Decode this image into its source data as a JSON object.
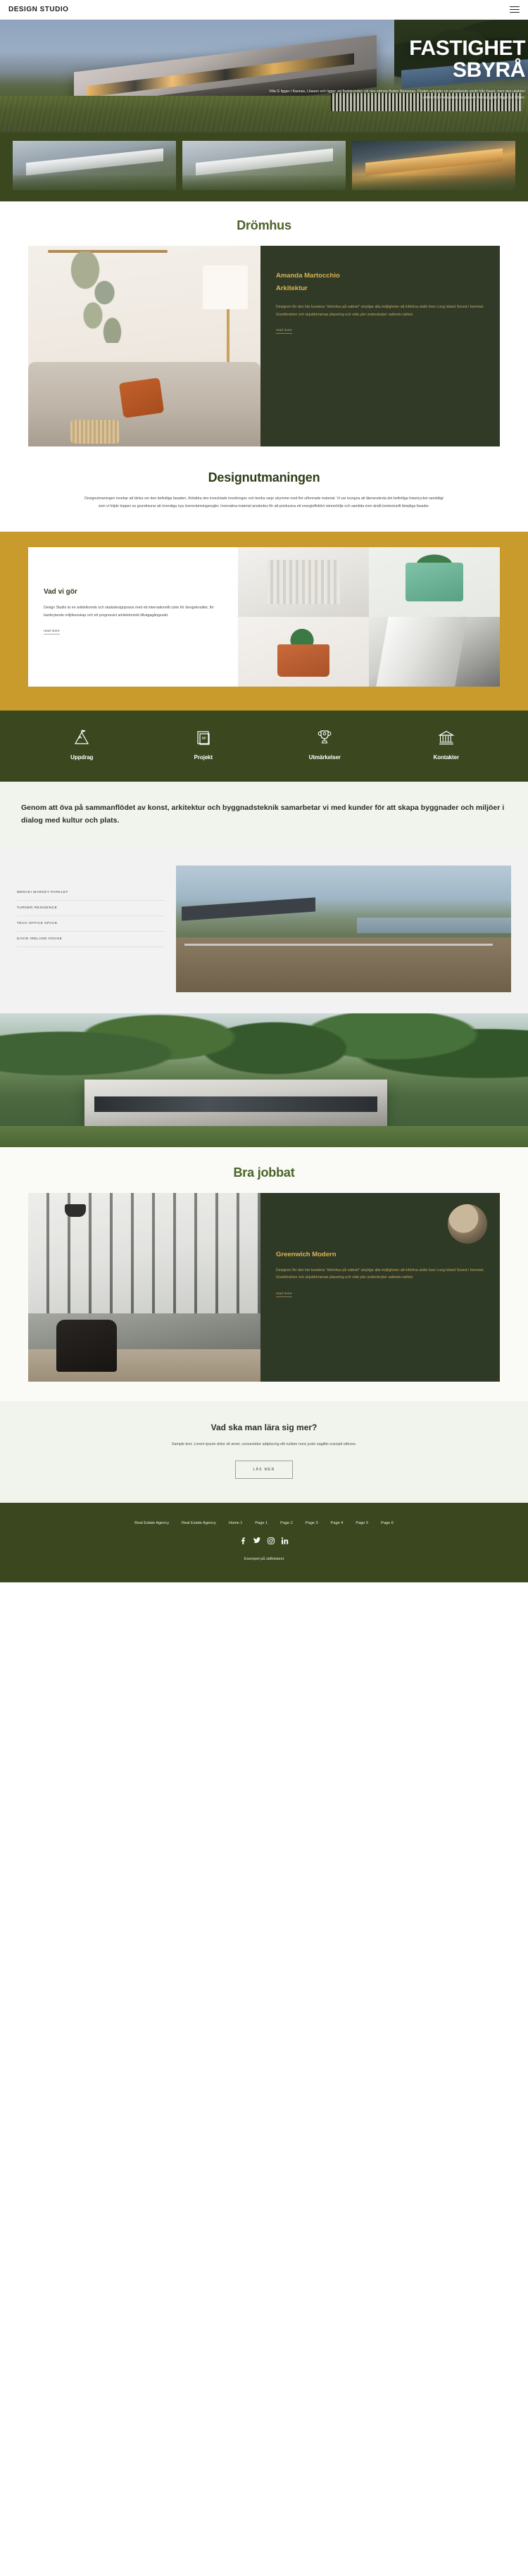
{
  "header": {
    "brand": "DESIGN STUDIO",
    "menu_icon": "hamburger-menu-icon"
  },
  "hero": {
    "title_line1": "FASTIGHET",
    "title_line2": "SBYRÅ",
    "description": "Villa G ligger i Kaunas, Litauen och ligger vid flodstranden vid den största floden Nemunas. Floden erbjuder en enastående utsikt från huset, men den utsikten vetter mot norra sidan av platsen medan gatan ligger på Söder."
  },
  "gallery": {
    "items": [
      "villa-exterior-photo-1",
      "villa-exterior-photo-2",
      "villa-exterior-photo-3"
    ]
  },
  "dream": {
    "title": "Drömhus",
    "image": "living-room-interior-photo",
    "card_title_line1": "Amanda Martocchio",
    "card_title_line2": "Arkitektur",
    "card_text": "Designen för den här kundens \"drömhus på vattnet\" utnyttjar alla möjligheter att införliva utsikt över Long Island Sound i hemmet. Granfönstren och skjutdörrarnas placering och vida ytor understryker vattnets närhet.",
    "read_more": "read more"
  },
  "challenge": {
    "title": "Designutmaningen",
    "text": "Designutmaningen innebar att tänka om den befintliga fasaden, förbättra den invecklade inredningen och berika varje utrymme med fint utformade material. Vi var tvungna att återanvända det befintliga fotavtrycket samtidigt som vi höjde toppen av grundmurar att överstiga nya översvämningsregler. Innovativa material användes för att producera ett energieffektivt värmehölje och samtida men ändå kontextuellt lämpliga fasader."
  },
  "what_we_do": {
    "title": "Vad vi gör",
    "text": "Design Studio är en arkitektonisk och stadsdesignpraxis med ett internationellt rykte för designkvalitet, för banbrytande miljökunskap och ett progressivt arkitektoniskt tillvägagångssätt.",
    "read_more": "read more",
    "tiles": [
      "paper-fan-object-photo",
      "green-planter-photo",
      "terracotta-planter-hand-photo",
      "white-curved-paper-photo"
    ]
  },
  "icon_row": {
    "items": [
      {
        "label": "Uppdrag",
        "icon": "mountain-flag-icon"
      },
      {
        "label": "Projekt",
        "icon": "documents-m2-icon"
      },
      {
        "label": "Utmärkelser",
        "icon": "trophy-icon"
      },
      {
        "label": "Kontakter",
        "icon": "bank-building-icon"
      }
    ]
  },
  "statement": {
    "text": "Genom att öva på sammanflödet av konst, arkitektur och byggnadsteknik samarbetar vi med kunder för att skapa byggnader och miljöer i dialog med kultur och plats."
  },
  "project_list": {
    "items": [
      "MERAKI MARKET PARKLET",
      "TURNER RESIDENCE",
      "TECH OFFICE SPACE",
      "DAVID IRELAND HOUSE"
    ],
    "image": "coastal-house-deck-photo"
  },
  "wide_image": {
    "alt": "modern-house-in-forest-photo"
  },
  "good_work": {
    "title": "Bra jobbat",
    "image": "modern-interior-with-chair-photo",
    "avatar": "architect-portrait-avatar",
    "card_title": "Greenwich Modern",
    "card_text": "Designen för den här kundens \"drömhus på vattnet\" utnyttjar alla möjligheter att införliva utsikt över Long Island Sound i hemmet. Granfönstren och skjutdörrarnas placering och vida ytor understryker vattnets närhet.",
    "read_more": "read more"
  },
  "learn_more": {
    "title": "Vad ska man lära sig mer?",
    "text": "Sample text. Lorem ipsum dolor sit amet, consectetur adipiscing elit nullam nunc justo sagittis suscipit ultrices.",
    "button": "LÄS MER"
  },
  "footer": {
    "links": [
      "Real Estate Agency",
      "Real Estate Agency",
      "Home 1",
      "Page 1",
      "Page 2",
      "Page 3",
      "Page 4",
      "Page 5",
      "Page 6"
    ],
    "social": [
      {
        "name": "facebook-icon",
        "glyph": "f"
      },
      {
        "name": "twitter-icon",
        "glyph": "🐦"
      },
      {
        "name": "instagram-icon",
        "glyph": "◉"
      },
      {
        "name": "linkedin-icon",
        "glyph": "in"
      }
    ],
    "note": "Exempel på sidfotstext"
  },
  "colors": {
    "green_dark": "#3a471f",
    "green_card": "#303a27",
    "gold": "#c89b2c",
    "gold_text": "#dcb457",
    "title_green": "#4a6326",
    "light_bg": "#f1f4ec"
  }
}
